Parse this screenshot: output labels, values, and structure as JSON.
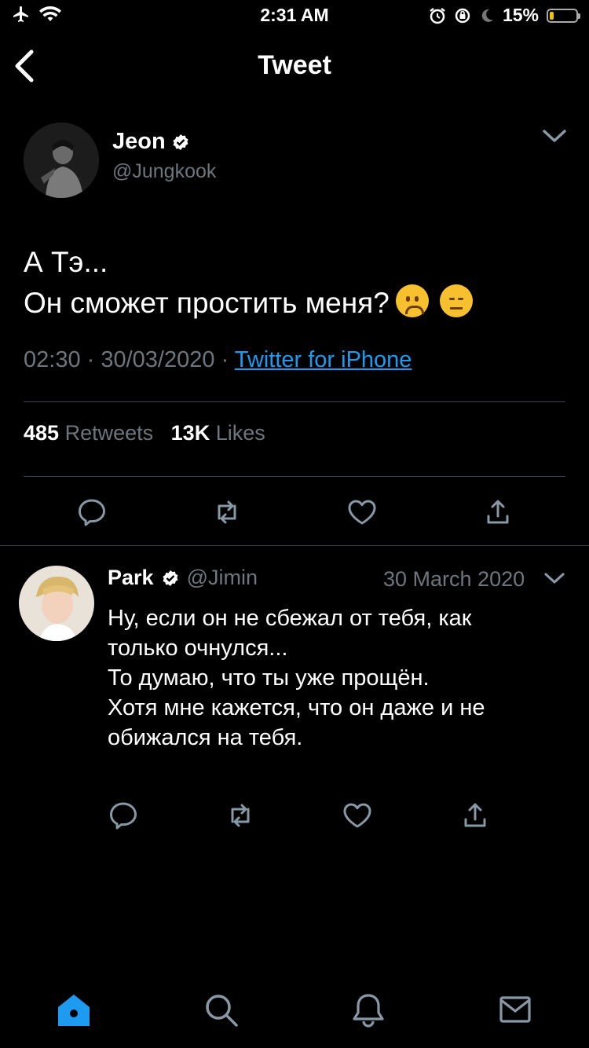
{
  "status_bar": {
    "time": "2:31 AM",
    "battery": "15%"
  },
  "header": {
    "title": "Tweet"
  },
  "tweet": {
    "author_name": "Jeon",
    "author_handle": "@Jungkook",
    "text_lines": [
      "А Тэ...",
      "Он сможет простить меня?"
    ],
    "time": "02:30",
    "date": "30/03/2020",
    "source": "Twitter for iPhone",
    "retweets_count": "485",
    "retweets_label": "Retweets",
    "likes_count": "13K",
    "likes_label": "Likes"
  },
  "reply": {
    "author_name": "Park",
    "author_handle": "@Jimin",
    "date": "30 March 2020",
    "text_lines": [
      "Ну, если он не сбежал от тебя, как",
      "только очнулся...",
      "То думаю, что ты уже прощён.",
      "Хотя мне кажется, что он даже и не",
      "обижался на тебя."
    ]
  },
  "colors": {
    "accent": "#1d9bf0",
    "muted": "#6e767d",
    "divider": "#38444d",
    "background": "#000000"
  },
  "icons": [
    "airplane-icon",
    "wifi-icon",
    "alarm-icon",
    "rotation-lock-icon",
    "moon-icon",
    "battery-icon",
    "back-chevron-icon",
    "verified-badge-icon",
    "chevron-down-icon",
    "reply-icon",
    "retweet-icon",
    "like-icon",
    "share-icon",
    "home-icon",
    "search-icon",
    "notifications-icon",
    "messages-icon"
  ]
}
